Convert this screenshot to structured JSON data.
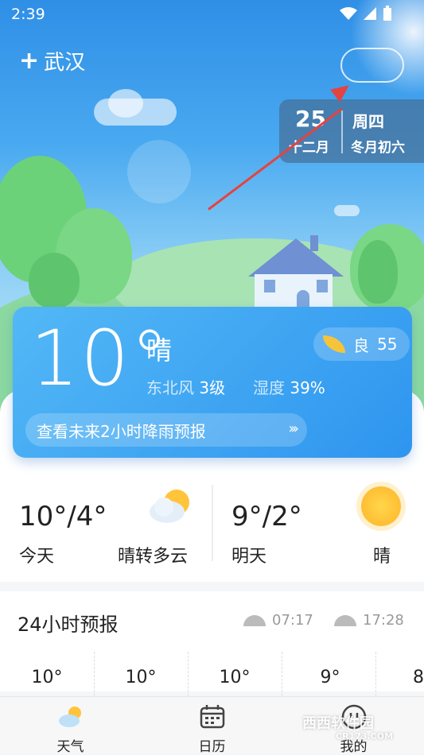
{
  "status_bar": {
    "time": "2:39"
  },
  "header": {
    "city": "武汉"
  },
  "date_card": {
    "day": "25",
    "lunar_month": "十二月",
    "weekday": "周四",
    "lunar_day": "冬月初六"
  },
  "current": {
    "temp": "10°",
    "condition": "晴",
    "wind_label": "东北风",
    "wind_value": "3级",
    "humidity_label": "湿度",
    "humidity_value": "39%",
    "aqi_label": "良",
    "aqi_value": "55",
    "rain_link": "查看未来2小时降雨预报"
  },
  "today": {
    "temp": "10°/4°",
    "label": "今天",
    "condition": "晴转多云"
  },
  "tomorrow": {
    "temp": "9°/2°",
    "label": "明天",
    "condition": "晴"
  },
  "forecast24": {
    "title": "24小时预报",
    "sunrise": "07:17",
    "sunset": "17:28",
    "hours": [
      "10°",
      "10°",
      "10°",
      "9°",
      "8"
    ]
  },
  "tabs": [
    {
      "label": "天气",
      "icon": "weather-icon"
    },
    {
      "label": "日历",
      "icon": "calendar-icon"
    },
    {
      "label": "我的",
      "icon": "profile-icon"
    }
  ],
  "watermark": {
    "text": "西西软件园",
    "subtext": "CR173.COM"
  },
  "colors": {
    "accent": "#2e95ef",
    "annotation_arrow": "#e5433f"
  }
}
